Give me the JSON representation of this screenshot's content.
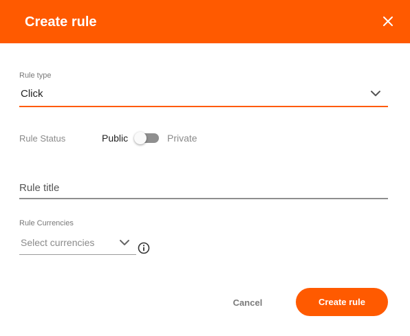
{
  "header": {
    "title": "Create rule",
    "close_icon": "close-icon"
  },
  "rule_type": {
    "label": "Rule type",
    "value": "Click"
  },
  "rule_status": {
    "label": "Rule Status",
    "option_left": "Public",
    "option_right": "Private",
    "selected": "Public"
  },
  "rule_title": {
    "placeholder": "Rule title",
    "value": ""
  },
  "rule_currencies": {
    "label": "Rule Currencies",
    "placeholder": "Select currencies",
    "info_icon": "info-icon"
  },
  "footer": {
    "cancel_label": "Cancel",
    "create_label": "Create rule"
  },
  "colors": {
    "accent": "#ff5a00",
    "toggle_track": "#8f8f8f",
    "muted_text": "#8a8a8a"
  }
}
